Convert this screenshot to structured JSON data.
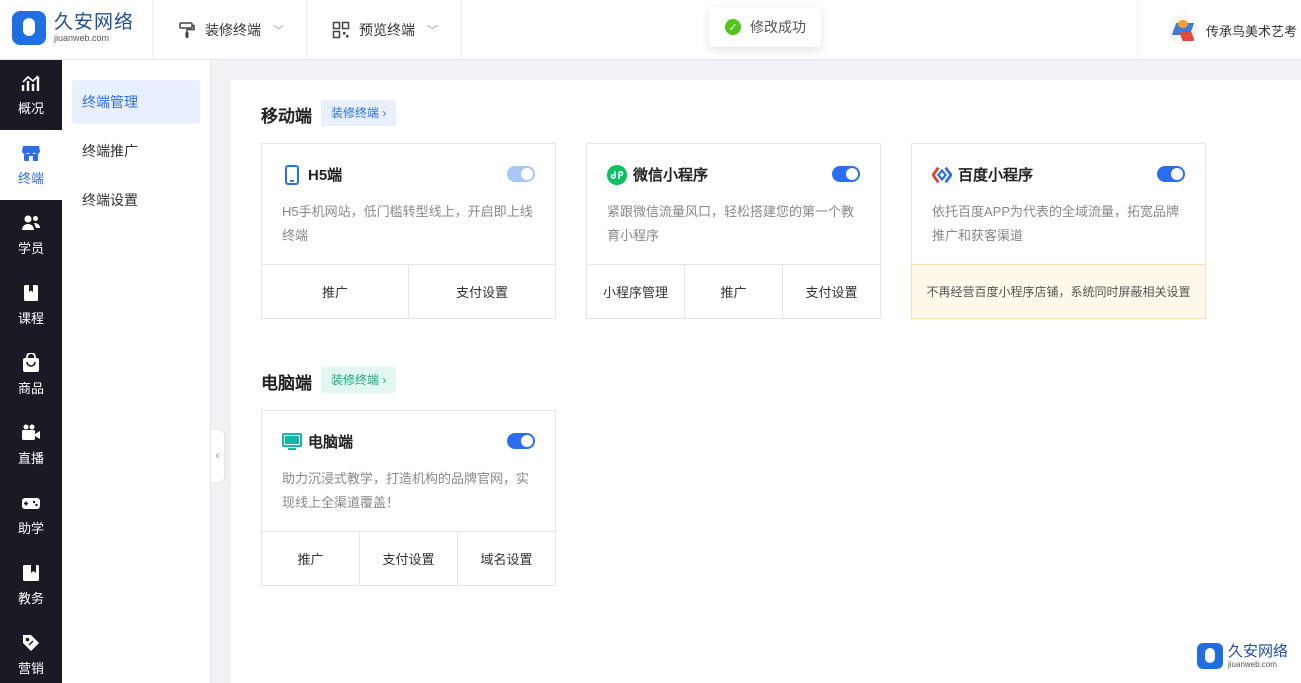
{
  "brand": {
    "name_cn": "久安网络",
    "name_en": "jiuanweb.com"
  },
  "topnav": [
    {
      "label": "装修终端",
      "icon": "paint-roller-icon"
    },
    {
      "label": "预览终端",
      "icon": "qr-code-icon"
    }
  ],
  "toast": {
    "message": "修改成功",
    "status": "success"
  },
  "user": {
    "name": "传承鸟美术艺考"
  },
  "sidebar": [
    {
      "label": "概况",
      "icon": "chart-icon"
    },
    {
      "label": "终端",
      "icon": "store-icon",
      "active": true
    },
    {
      "label": "学员",
      "icon": "users-icon"
    },
    {
      "label": "课程",
      "icon": "book-icon"
    },
    {
      "label": "商品",
      "icon": "bag-icon"
    },
    {
      "label": "直播",
      "icon": "video-icon"
    },
    {
      "label": "助学",
      "icon": "gamepad-icon"
    },
    {
      "label": "教务",
      "icon": "notebook-icon"
    },
    {
      "label": "营销",
      "icon": "tag-icon"
    }
  ],
  "submenu": [
    {
      "label": "终端管理",
      "active": true
    },
    {
      "label": "终端推广"
    },
    {
      "label": "终端设置"
    }
  ],
  "sections": {
    "mobile": {
      "title": "移动端",
      "link": "装修终端"
    },
    "pc": {
      "title": "电脑端",
      "link": "装修终端"
    }
  },
  "cards": {
    "h5": {
      "title": "H5端",
      "enabled": true,
      "desc": "H5手机网站，低门槛转型线上，开启即上线终端",
      "actions": [
        "推广",
        "支付设置"
      ]
    },
    "wechat": {
      "title": "微信小程序",
      "enabled": true,
      "desc": "紧跟微信流量风口，轻松搭建您的第一个教育小程序",
      "actions": [
        "小程序管理",
        "推广",
        "支付设置"
      ]
    },
    "baidu": {
      "title": "百度小程序",
      "enabled": true,
      "desc": "依托百度APP为代表的全域流量，拓宽品牌推广和获客渠道",
      "notice": "不再经营百度小程序店铺，系统同时屏蔽相关设置"
    },
    "pc": {
      "title": "电脑端",
      "enabled": true,
      "desc": "助力沉浸式教学，打造机构的品牌官网，实现线上全渠道覆盖！",
      "actions": [
        "推广",
        "支付设置",
        "域名设置"
      ]
    }
  },
  "colors": {
    "accent": "#2a6ef0",
    "sidebar_bg": "#191a23",
    "success": "#52c41a",
    "notice_bg": "#fdf8ea"
  }
}
